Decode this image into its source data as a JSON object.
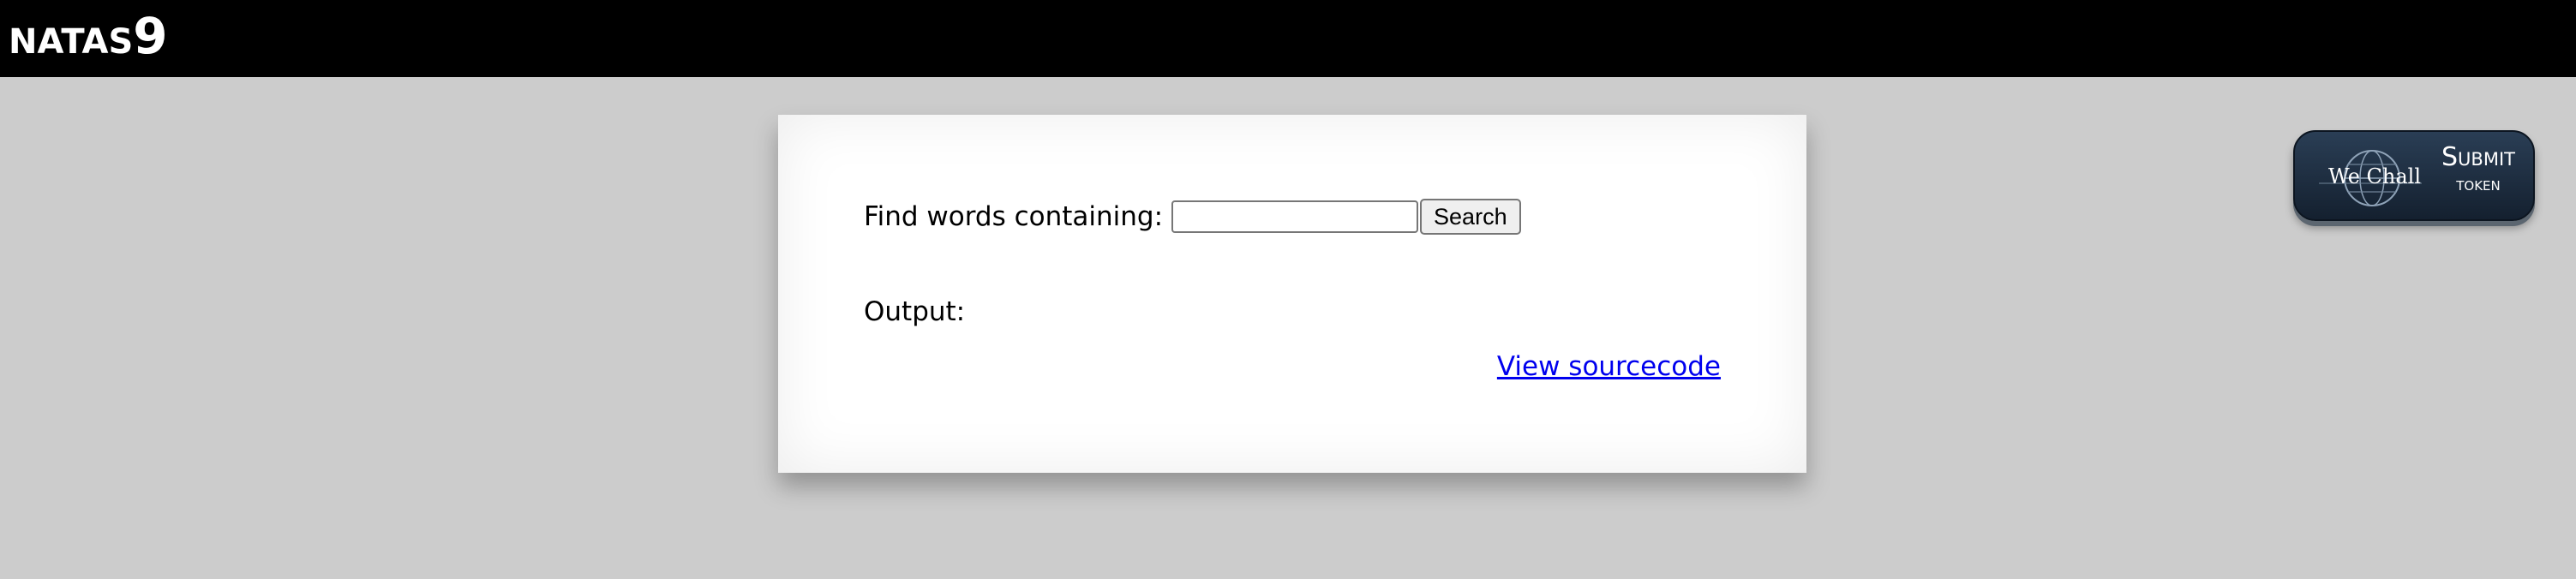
{
  "header": {
    "title_prefix": "NATAS",
    "title_number": "9",
    "background_color": "#000000"
  },
  "form": {
    "search_label": "Find words containing:",
    "search_value": "",
    "search_placeholder": "",
    "search_button_label": "Search"
  },
  "output": {
    "label": "Output:"
  },
  "links": {
    "view_source_label": "View sourcecode"
  },
  "token_button": {
    "logo_text": "We Chall",
    "label_line1": "Submit",
    "label_line2": "token",
    "icon": "globe-icon"
  },
  "colors": {
    "page_background": "#cccccc",
    "link": "#0000ee",
    "token_button": "#1c2a3b"
  }
}
